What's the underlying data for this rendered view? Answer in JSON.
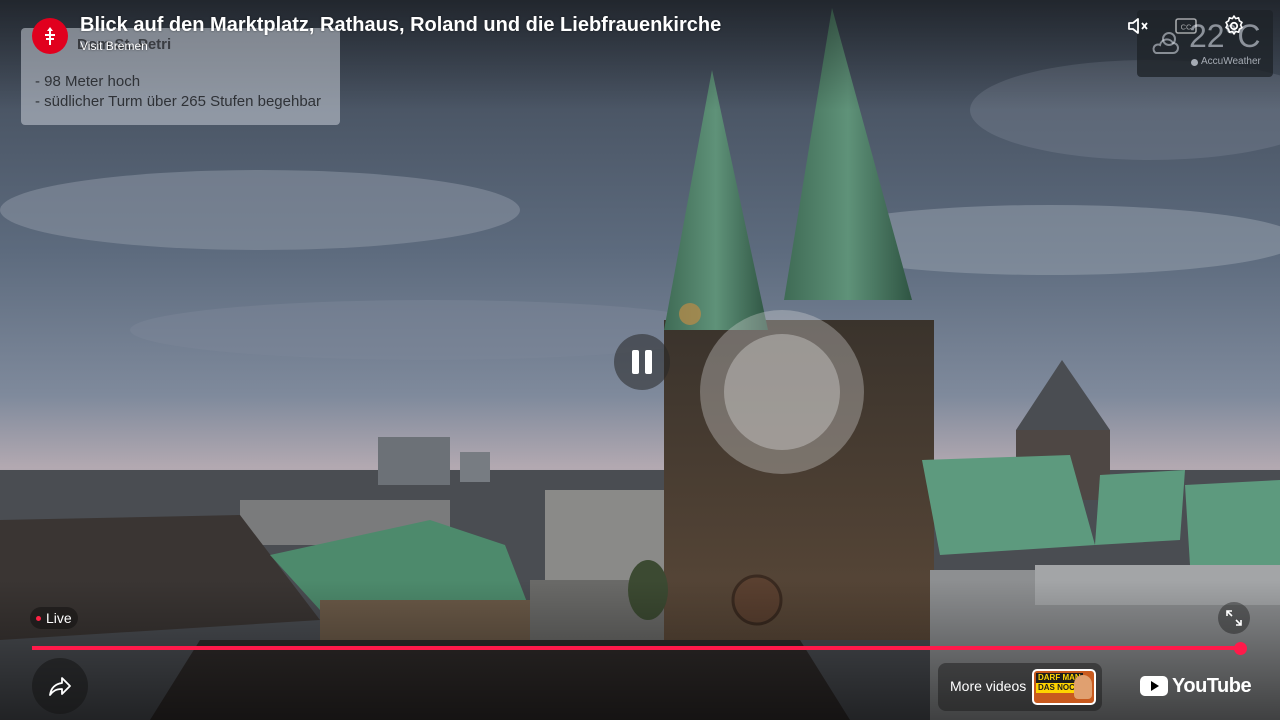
{
  "player": {
    "title": "Blick auf den Marktplatz, Rathaus, Roland und die Liebfrauenkirche",
    "channel": "Visit Bremen",
    "live_label": "Live",
    "progress_fraction": 0.995,
    "more_videos_label": "More videos",
    "youtube_label": "YouTube",
    "accent_color": "#ff1a4a"
  },
  "overlay_info": {
    "title": "Dom St. Petri",
    "lines": [
      "- 98 Meter hoch",
      "- südlicher Turm über 265 Stufen begehbar"
    ]
  },
  "weather": {
    "temperature": "22°C",
    "provider": "AccuWeather",
    "icon": "cloud-sun-icon"
  },
  "thumbnail": {
    "line1": "DARF MAN",
    "line2": "DAS NOCH?!"
  },
  "icons": {
    "mute": "volume-muted-icon",
    "captions": "captions-icon",
    "settings": "gear-icon",
    "pause": "pause-icon",
    "share": "share-icon",
    "fullscreen": "exit-fullscreen-icon"
  }
}
